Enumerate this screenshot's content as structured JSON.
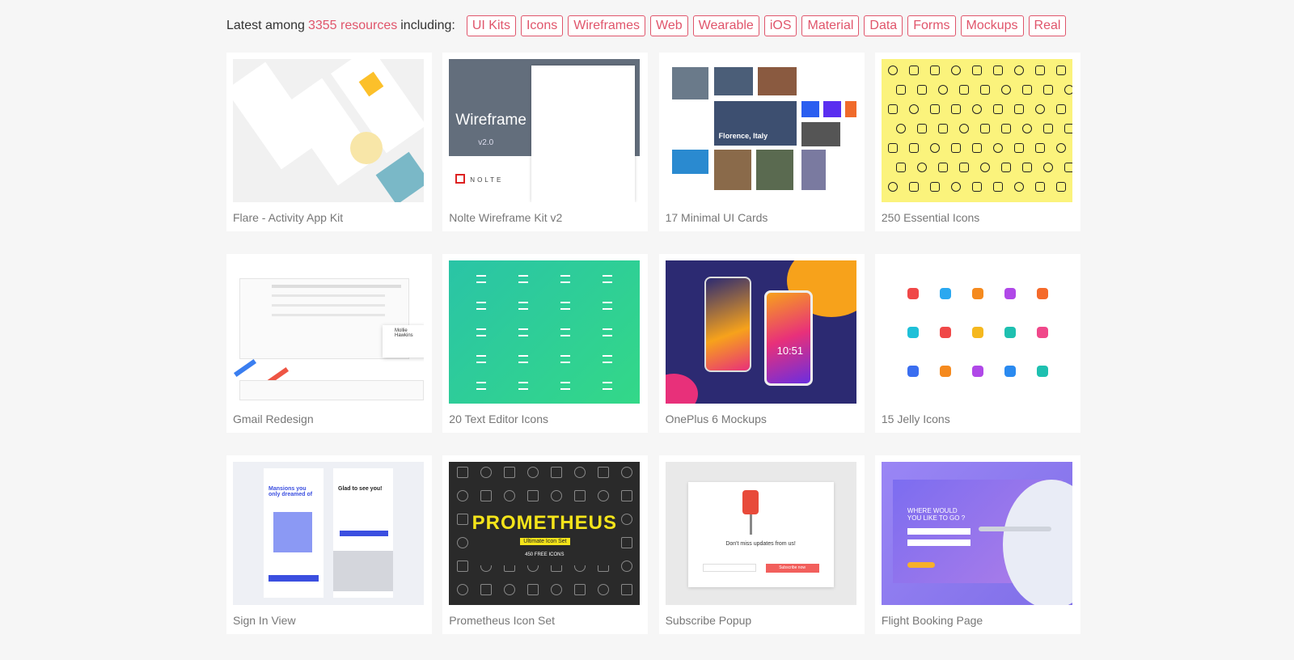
{
  "header": {
    "prefix": "Latest among",
    "count_link": "3355 resources",
    "suffix": "including:",
    "tags": [
      "UI Kits",
      "Icons",
      "Wireframes",
      "Web",
      "Wearable",
      "iOS",
      "Material",
      "Data",
      "Forms",
      "Mockups",
      "Real"
    ]
  },
  "accent_color": "#e0556b",
  "cards": [
    {
      "title": "Flare - Activity App Kit"
    },
    {
      "title": "Nolte Wireframe Kit v2",
      "thumb_text": "Wireframe Kit",
      "thumb_version": "v2.0",
      "thumb_logo": "NOLTE"
    },
    {
      "title": "17 Minimal UI Cards",
      "thumb_text": "Florence, Italy"
    },
    {
      "title": "250 Essential Icons"
    },
    {
      "title": "Gmail Redesign",
      "thumb_text": "Mollie Hawkins"
    },
    {
      "title": "20 Text Editor Icons"
    },
    {
      "title": "OnePlus 6 Mockups",
      "thumb_text": "10:51"
    },
    {
      "title": "15 Jelly Icons"
    },
    {
      "title": "Sign In View",
      "thumb_text": "Mansions you only dreamed of",
      "thumb_text2": "Glad to see you!"
    },
    {
      "title": "Prometheus Icon Set",
      "thumb_text": "PROMETHEUS",
      "thumb_sub": "Ultimate Icon Set",
      "thumb_sub2": "450 FREE ICONS"
    },
    {
      "title": "Subscribe Popup",
      "thumb_text": "Don't miss updates from us!",
      "thumb_button": "Subscribe now"
    },
    {
      "title": "Flight Booking Page",
      "thumb_text": "WHERE WOULD YOU LIKE TO GO ?"
    }
  ]
}
